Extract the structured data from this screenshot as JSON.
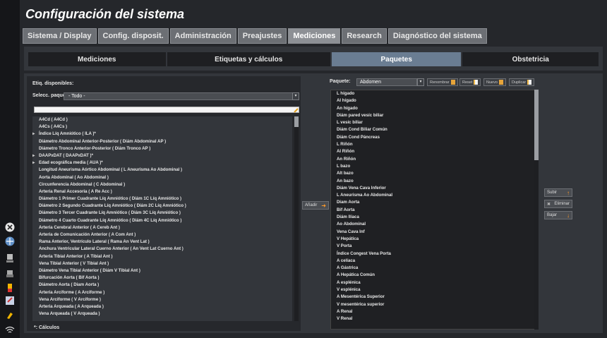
{
  "title": "Configuración del sistema",
  "tabs": [
    "Sistema / Display",
    "Config. disposit.",
    "Administración",
    "Preajustes",
    "Mediciones",
    "Research",
    "Diagnóstico del sistema"
  ],
  "active_tab": "Mediciones",
  "subtabs": [
    "Mediciones",
    "Etiquetas y cálculos",
    "Paquetes",
    "Obstetricia"
  ],
  "active_subtab": "Paquetes",
  "left": {
    "header": "Etiq. disponibles:",
    "select_label": "Selecc. paquete",
    "select_value": "- Todo -",
    "search_value": "",
    "items": [
      "A4Cd ( A4Cd )",
      "A4Cs ( A4Cs )",
      "Índice Líq Amniótico ( ILA )*",
      "Diámetro Abdominal Anterior-Posterior ( Diám Abdominal AP )",
      "Diámetro Tronco Anterior-Posterior ( Diám Tronco AP )",
      "DAAPxDAT ( DAAPxDAT )*",
      "Edad ecográfica media ( AUA )*",
      "Longitud Aneurisma Aórtico Abdominal ( L Aneurisma Ao Abdominal )",
      "Aorta Abdominal ( Ao Abdominal )",
      "Circunferencia Abdominal ( C Abdominal )",
      "Arteria Renal Accesoria ( A Re Acc )",
      "Diámetro 1 Primer Cuadrante Líq Amniótico ( Diám 1C Líq Amniótico )",
      "Diámetro 2 Segundo Cuadrante Líq Amniótico ( Diám 2C Líq Amniótico )",
      "Diámetro 3 Tercer Cuadrante Líq Amniótico ( Diám 3C Líq Amniótico )",
      "Diámetro 4 Cuarto Cuadrante Líq Amniótico ( Diám 4C Líq Amniótico )",
      "Arteria Cerebral Anterior ( A Cereb Ant )",
      "Arteria de Comunicación Anterior ( A Com Ant )",
      "Rama Anterior, Ventrículo Lateral ( Rama An Vent Lat )",
      "Anchura Ventricular Lateral Cuerno Anterior ( An Vent Lat Cuerno Ant )",
      "Arteria Tibial Anterior ( A Tibial Ant )",
      "Vena Tibial Anterior ( V Tibial Ant )",
      "Diámetro Vena Tibial Anterior ( Diám V Tibial Ant )",
      "Bifurcación Aorta ( Bif Aorta )",
      "Diámetro Aorta ( Diam Aorta )",
      "Arteria Arciforme ( A Arciforme )",
      "Vena Arciforme ( V Arciforme )",
      "Arteria Arqueada ( A Arqueada )",
      "Vena Arqueada ( V Arqueada )"
    ],
    "expandable": [
      2,
      5,
      6
    ],
    "note": "*: Cálculos"
  },
  "add_label": "Añadir",
  "right": {
    "paquete_label": "Paquete:",
    "paquete_value": "Abdomen",
    "toolbar": [
      "Renombrar",
      "Reset",
      "Nuevo",
      "Duplicar"
    ],
    "items": [
      "L hígado",
      "Al hígado",
      "An hígado",
      "Diám pared vesíc biliar",
      "L vesíc biliar",
      "Diám Cond Biliar Común",
      "Diám Cond Páncreas",
      "L Riñón",
      "Al Riñón",
      "An Riñón",
      "L bazo",
      "Alt bazo",
      "An bazo",
      "Diám Vena Cava Inferior",
      "L Aneurisma Ao Abdominal",
      "Diam Aorta",
      "Bif Aorta",
      "Diám Ilíaca",
      "Ao Abdominal",
      "Vena Cava Inf",
      "V Hepática",
      "V Porta",
      "Índice Congest Vena Porta",
      "A celíaca",
      "A Gástrica",
      "A Hepática Común",
      "A esplénica",
      "V esplénica",
      "A Mesentérica Superior",
      "V mesentérica superior",
      "A Renal",
      "V Renal"
    ],
    "side_buttons": [
      "Subir",
      "Eliminar",
      "Bajar"
    ]
  }
}
